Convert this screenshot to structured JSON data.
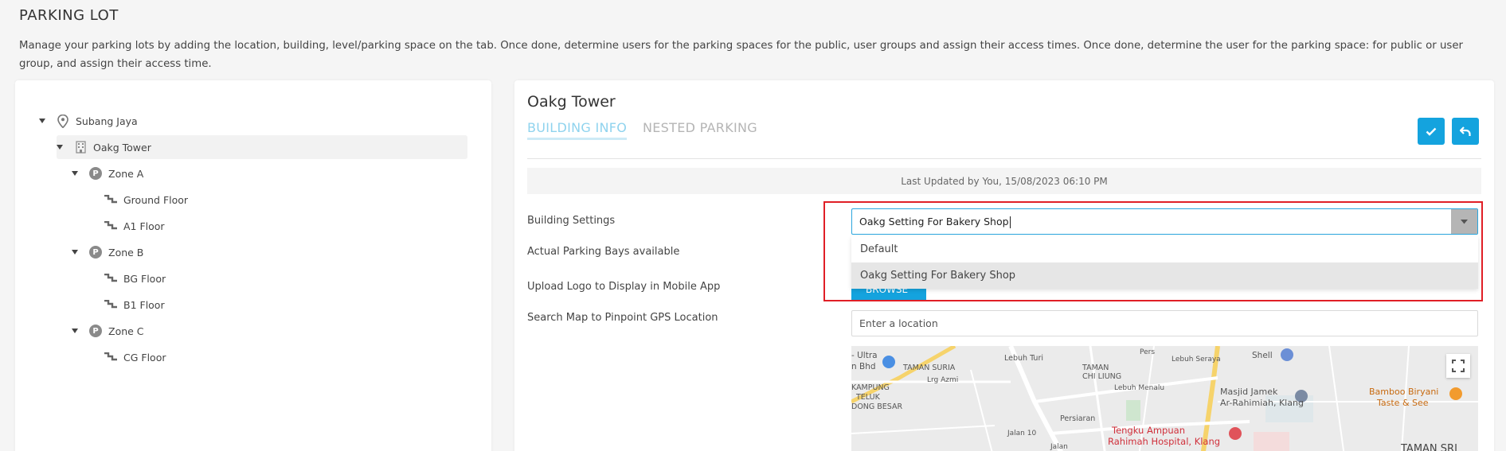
{
  "header": {
    "title": "PARKING LOT",
    "description": "Manage your parking lots by adding the location, building, level/parking space on the tab. Once done, determine users for the parking spaces for the public, user groups and assign their access times. Once done, determine the user for the parking space: for public or user group, and assign their access time."
  },
  "tree": {
    "location": "Subang Jaya",
    "building": "Oakg Tower",
    "zone_a": "Zone A",
    "zone_a_floor_1": "Ground Floor",
    "zone_a_floor_2": "A1 Floor",
    "zone_b": "Zone B",
    "zone_b_floor_1": "BG Floor",
    "zone_b_floor_2": "B1 Floor",
    "zone_c": "Zone C",
    "zone_c_floor_1": "CG Floor",
    "zone_badge": "P"
  },
  "detail": {
    "title": "Oakg Tower",
    "tabs": {
      "building_info": "BUILDING INFO",
      "nested_parking": "NESTED PARKING"
    },
    "last_updated": "Last Updated by You, 15/08/2023 06:10 PM",
    "labels": {
      "building_settings": "Building Settings",
      "parking_bays": "Actual Parking Bays available",
      "upload_logo": "Upload Logo to Display in Mobile App",
      "search_map": "Search Map to Pinpoint GPS Location"
    },
    "building_settings_value": "Oakg Setting For Bakery Shop",
    "dropdown_options": [
      "Default",
      "Oakg Setting For Bakery Shop"
    ],
    "browse_label": "BROWSE",
    "location_placeholder": "Enter a location",
    "accent_color": "#14a3de",
    "highlight_color": "#e01f26"
  },
  "map": {
    "labels": {
      "ultra": "- Ultra",
      "bhd": "n Bhd",
      "taman_suria": "TAMAN SURIA",
      "lebuh_turi": "Lebuh Turi",
      "taman": "TAMAN",
      "chi_liung": "CHI LIUNG",
      "lebuh_seraya": "Lebuh Seraya",
      "shell": "Shell",
      "kampung": "KAMPUNG",
      "teluk": "TELUK",
      "dong_besar": "DONG BESAR",
      "lrg_azmi": "Lrg Azmi",
      "lebuh_menalu": "Lebuh Menalu",
      "masjid1": "Masjid Jamek",
      "masjid2": "Ar-Rahimiah, Klang",
      "bamboo1": "Bamboo Biryani",
      "bamboo2": "Taste & See",
      "persiaran": "Persiaran",
      "tengku1": "Tengku Ampuan",
      "tengku2": "Rahimah Hospital, Klang",
      "jalan": "Jalan",
      "taman_sri": "TAMAN SRI",
      "jalan10": "Jalan 10",
      "pers": "Pers"
    }
  }
}
